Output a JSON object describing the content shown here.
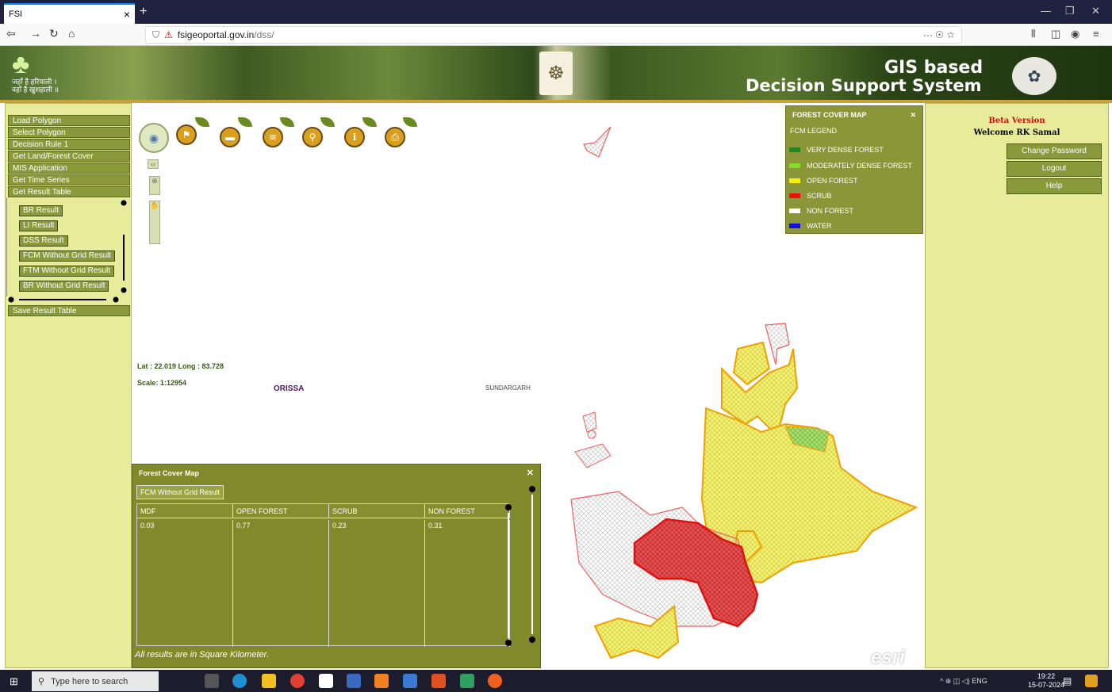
{
  "browser": {
    "tab_title": "FSI",
    "tab_close": "×",
    "new_tab": "+",
    "url_domain": "fsigeoportal.gov.in",
    "url_path": "/dss/",
    "url_extra": "··· ☉ ☆"
  },
  "banner": {
    "gis_line1": "GIS based",
    "gis_line2": "Decision Support System",
    "logo_text1": "जहाँ है हरियाली ।",
    "logo_text2": "वहाँ है खुशहाली ॥"
  },
  "left_menu": {
    "items": [
      "Load Polygon",
      "Select Polygon",
      "Decision Rule 1",
      "Get Land/Forest Cover",
      "MIS Application",
      "Get Time Series",
      "Get Result Table"
    ],
    "sub_items": [
      "BR Result",
      "LI Result",
      "DSS Result",
      "FCM Without Grid Result",
      "FTM Without Grid Result",
      "BR Without Grid Result"
    ],
    "save": "Save Result Table"
  },
  "map": {
    "lat_long": "Lat : 22.019 Long : 83.728",
    "scale": "Scale: 1:12954",
    "state_label": "ORISSA",
    "district_label": "SUNDARGARH",
    "attribution": "esri"
  },
  "legend": {
    "title": "FOREST COVER MAP",
    "close": "✕",
    "subtitle": "FCM LEGEND",
    "items": [
      {
        "label": "VERY DENSE FOREST",
        "color": "#1f8a1f"
      },
      {
        "label": "MODERATELY DENSE FOREST",
        "color": "#7ee020"
      },
      {
        "label": "OPEN FOREST",
        "color": "#f4f000"
      },
      {
        "label": "SCRUB",
        "color": "#f01010"
      },
      {
        "label": "NON FOREST",
        "color": "#ffffff"
      },
      {
        "label": "WATER",
        "color": "#1010e0"
      }
    ]
  },
  "right_panel": {
    "beta": "Beta Version",
    "welcome": "Welcome RK Samal",
    "change_password": "Change Password",
    "logout": "Logout",
    "help": "Help"
  },
  "result": {
    "title": "Forest Cover Map",
    "close": "✕",
    "tab": "FCM Without Grid Result",
    "headers": [
      "MDF",
      "OPEN FOREST",
      "SCRUB",
      "NON FOREST"
    ],
    "values": [
      "0.03",
      "0.77",
      "0.23",
      "0.31"
    ],
    "footnote": "All results are in Square Kilometer."
  },
  "taskbar": {
    "search_placeholder": "Type here to search",
    "time": "19:22",
    "date": "15-07-2024",
    "lang": "ENG"
  }
}
